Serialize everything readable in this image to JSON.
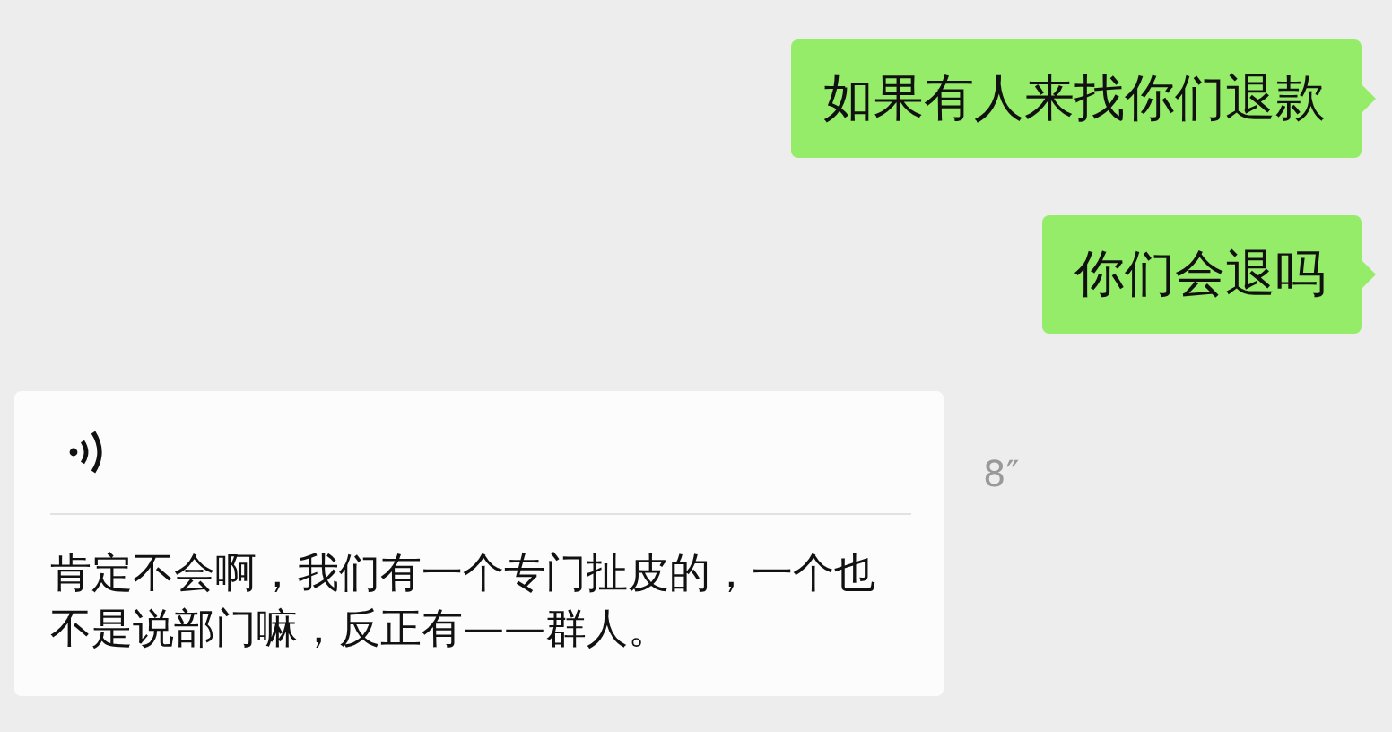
{
  "messages": [
    {
      "kind": "text",
      "outgoing": true,
      "text": "如果有人来找你们退款"
    },
    {
      "kind": "text",
      "outgoing": true,
      "text": "你们会退吗"
    },
    {
      "kind": "voice",
      "outgoing": false,
      "duration": "8″",
      "transcript": "肯定不会啊，我们有一个专门扯皮的，一个也不是说部门嘛，反正有——群人。"
    }
  ]
}
